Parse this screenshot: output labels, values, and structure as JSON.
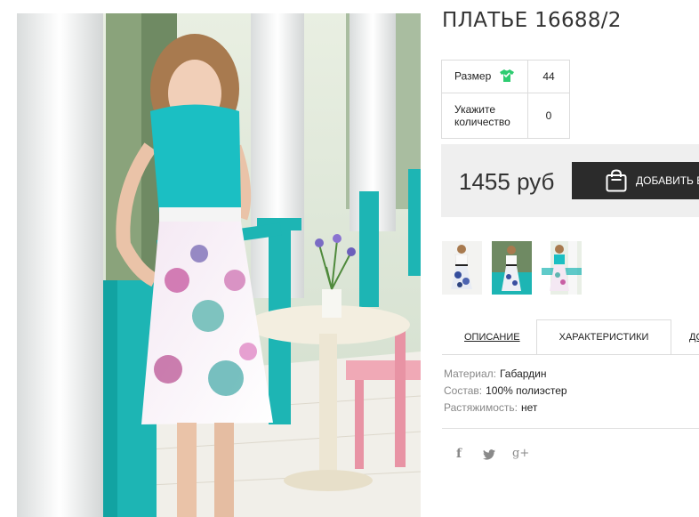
{
  "product": {
    "title": "ПЛАТЬЕ 16688/2"
  },
  "options": {
    "size_label": "Размер",
    "size_value": "44",
    "quantity_label": "Укажите количество",
    "quantity_value": "0"
  },
  "price": {
    "amount": "1455 руб",
    "cart_button_label": "ДОБАВИТЬ В КОРЗИНУ"
  },
  "tabs": {
    "description": "ОПИСАНИЕ",
    "characteristics": "ХАРАКТЕРИСТИКИ",
    "third": "ДОСТАВКА"
  },
  "specs": [
    {
      "key": "Материал:",
      "value": "Габардин"
    },
    {
      "key": "Состав:",
      "value": "100% полиэстер"
    },
    {
      "key": "Растяжимость:",
      "value": "нет"
    }
  ],
  "social": {
    "facebook": "f",
    "twitter": "twitter-icon",
    "gplus": "g+"
  },
  "colors": {
    "accent_green": "#2ecc71",
    "button_dark": "#2b2b2b",
    "price_bg": "#efefef",
    "dress_top": "#1bbfc3"
  }
}
